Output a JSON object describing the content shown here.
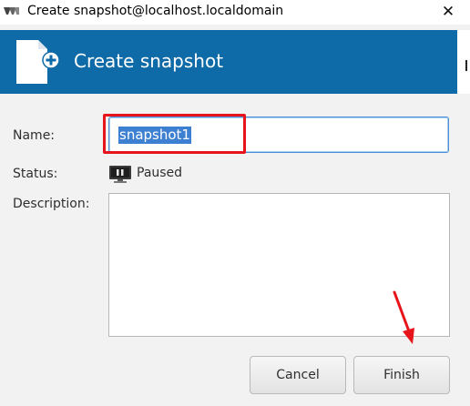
{
  "window": {
    "title": "Create snapshot@localhost.localdomain",
    "close_glyph": "✕",
    "app_icon": "virt-manager-icon"
  },
  "header": {
    "title": "Create snapshot",
    "icon": "new-document-icon",
    "background": "#0f6aa8"
  },
  "form": {
    "name_label": "Name:",
    "name_value": "snapshot1",
    "status_label": "Status:",
    "status_value": "Paused",
    "status_icon": "paused-monitor-icon",
    "description_label": "Description:",
    "description_value": ""
  },
  "buttons": {
    "cancel_label": "Cancel",
    "finish_label": "Finish"
  },
  "annotations": {
    "highlight_color": "#e8141b",
    "arrow_color": "#e8141b"
  }
}
